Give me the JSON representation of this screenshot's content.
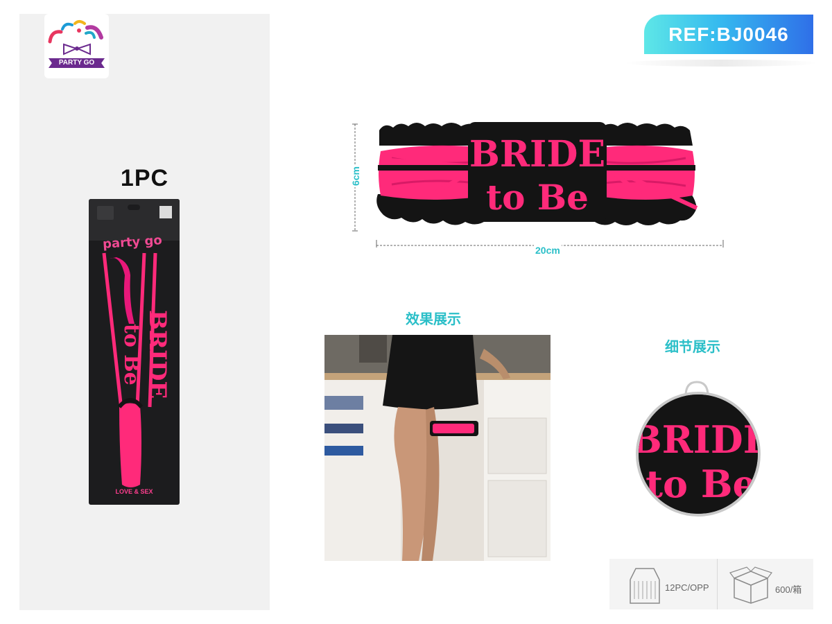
{
  "brand": {
    "name": "PARTY GO",
    "package_script": "party go"
  },
  "quantity_label": "1PC",
  "reference": "REF:BJ0046",
  "product": {
    "text_line1": "BRIDE",
    "text_line2": "to Be",
    "package_footer": "LOVE & SEX"
  },
  "dimensions": {
    "height": "6cm",
    "width": "20cm"
  },
  "sections": {
    "effect_title": "效果展示",
    "detail_title": "细节展示"
  },
  "packing": {
    "inner": "12PC/OPP",
    "outer": "600/箱"
  },
  "colors": {
    "accent_cyan": "#2bbfc8",
    "product_pink": "#ff2a7a",
    "lace_black": "#141414",
    "brand_purple": "#6b2a8e"
  }
}
